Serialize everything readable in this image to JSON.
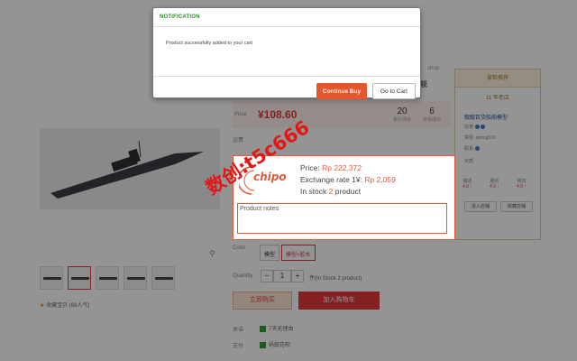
{
  "modal": {
    "title": "NOTIFICATION",
    "message": "Product successfully added to your cart",
    "continue_label": "Continue Buy",
    "goto_label": "Go to Cart"
  },
  "product": {
    "shop_tag": "shop",
    "title_tail": "军舰",
    "price_label": "Price",
    "price": "¥108.60",
    "stats": [
      {
        "value": "20",
        "label": "累计评价"
      },
      {
        "value": "6",
        "label": "交易成功"
      }
    ],
    "color_label": "Color",
    "options": [
      "模型",
      "模型+胶水"
    ],
    "quantity_label": "Quantity",
    "quantity": "1",
    "stock_text": "件(In Stock 2 product)",
    "favorite_text": "收藏宝贝 (68人气)",
    "buy_now_label": "立即购买",
    "add_cart_label": "加入购物车",
    "promise_label": "承诺",
    "promise_text": "7天无理由",
    "payment_label": "支付",
    "payment_text": "蚂蚁花呗",
    "shipping_label": "运费"
  },
  "shop": {
    "header": "掌柜推荐",
    "years": "11 年老店",
    "name": "靓靓百货船舶模型",
    "lines": [
      {
        "label": "信誉:",
        "badge": true
      },
      {
        "label": "掌柜: spring519",
        "badge": false
      },
      {
        "label": "联系:",
        "badge": true
      },
      {
        "label": "资质:",
        "badge": false
      }
    ],
    "ratings": [
      {
        "label": "描述",
        "value": "4.9 ↑"
      },
      {
        "label": "服务",
        "value": "4.9 ↑"
      },
      {
        "label": "物流",
        "value": "4.9 ↑"
      }
    ],
    "enter_shop": "进入店铺",
    "favorite_shop": "收藏店铺"
  },
  "chipo": {
    "logo": "chipo",
    "price_label": "Price: ",
    "price_value": "Rp 222,372",
    "rate_label": "Exchange rate 1¥: ",
    "rate_value": "Rp 2,059",
    "stock_prefix": "In stock ",
    "stock_value": "2",
    "stock_suffix": " product",
    "notes_placeholder": "Product notes"
  },
  "watermark": "数创:t5c666",
  "colors": {
    "accent": "#e4572e",
    "brand": "#e05a3a",
    "notification_title": "#2c8c2c"
  }
}
